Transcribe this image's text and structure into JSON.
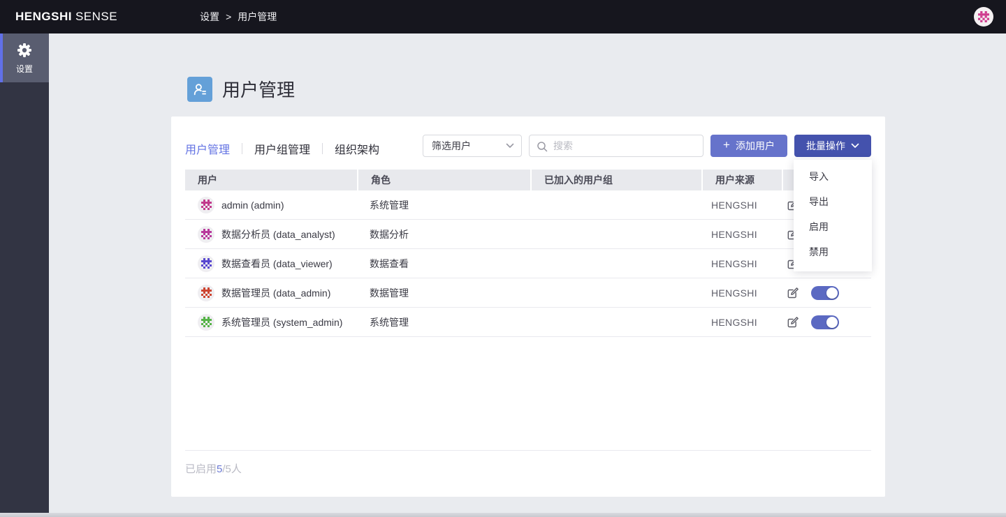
{
  "topbar": {
    "brand_bold": "HENGSHI",
    "brand_light": "SENSE",
    "breadcrumb_root": "设置",
    "breadcrumb_sep": ">",
    "breadcrumb_current": "用户管理",
    "avatar_color": "#cf3c8e"
  },
  "sidebar": {
    "settings_label": "设置"
  },
  "page": {
    "title": "用户管理"
  },
  "tabs": [
    {
      "label": "用户管理",
      "active": true
    },
    {
      "label": "用户组管理",
      "active": false
    },
    {
      "label": "组织架构",
      "active": false
    }
  ],
  "controls": {
    "filter_value": "筛选用户",
    "search_placeholder": "搜索",
    "add_label": "添加用户",
    "add_plus": "+",
    "batch_label": "批量操作"
  },
  "batch_menu": {
    "items": [
      {
        "label": "导入"
      },
      {
        "label": "导出"
      },
      {
        "label": "启用"
      },
      {
        "label": "禁用"
      }
    ]
  },
  "table": {
    "headers": [
      "用户",
      "角色",
      "已加入的用户组",
      "用户来源"
    ],
    "rows": [
      {
        "name": "admin (admin)",
        "role": "系统管理",
        "groups": "",
        "source": "HENGSHI",
        "enabled": true,
        "avatar_color": "#c23a8c"
      },
      {
        "name": "数据分析员 (data_analyst)",
        "role": "数据分析",
        "groups": "",
        "source": "HENGSHI",
        "enabled": true,
        "avatar_color": "#b8399b"
      },
      {
        "name": "数据查看员 (data_viewer)",
        "role": "数据查看",
        "groups": "",
        "source": "HENGSHI",
        "enabled": true,
        "avatar_color": "#5847d0"
      },
      {
        "name": "数据管理员 (data_admin)",
        "role": "数据管理",
        "groups": "",
        "source": "HENGSHI",
        "enabled": true,
        "avatar_color": "#cd4430"
      },
      {
        "name": "系统管理员 (system_admin)",
        "role": "系统管理",
        "groups": "",
        "source": "HENGSHI",
        "enabled": true,
        "avatar_color": "#56b348"
      }
    ]
  },
  "footer": {
    "prefix": "已启用",
    "enabled_count": "5",
    "suffix": "/5人"
  },
  "colors": {
    "accent": "#6373e3",
    "add_button": "#6673cb",
    "batch_button": "#4452ad",
    "toggle_on": "#5b69c2",
    "title_icon": "#64a0d8",
    "topbar": "#16161e",
    "sidebar": "#323443"
  }
}
